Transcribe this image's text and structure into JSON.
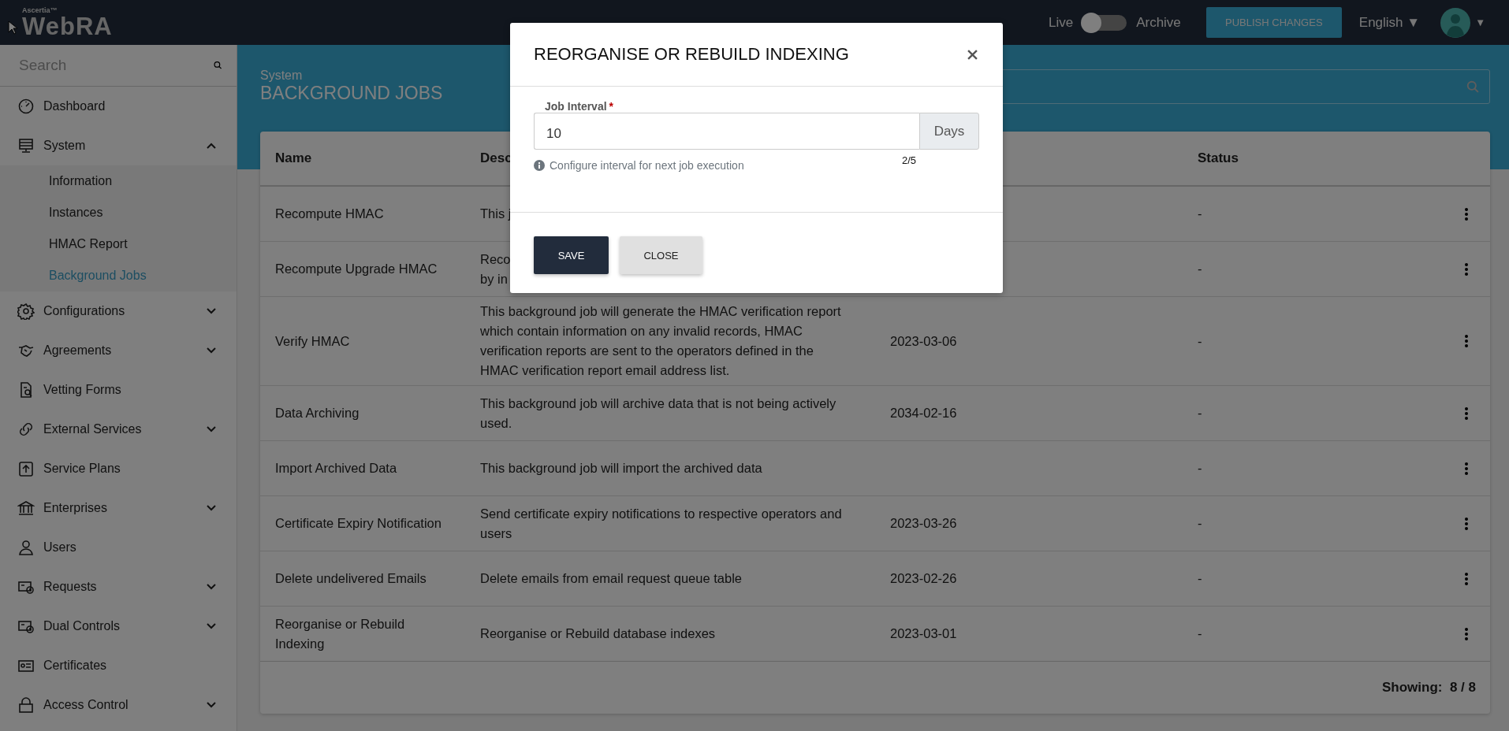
{
  "topbar": {
    "brand_small": "Ascertia™",
    "brand": "WebRA",
    "toggle": {
      "left_label": "Live",
      "right_label": "Archive",
      "on": false
    },
    "publish_button": "PUBLISH CHANGES",
    "language": "English ▼",
    "avatar_caret": "▼"
  },
  "sidebar": {
    "search": {
      "placeholder": "Search"
    },
    "items": [
      {
        "label": "Dashboard",
        "kind": "link"
      },
      {
        "label": "System",
        "kind": "group",
        "expanded": true,
        "children": [
          {
            "label": "Information",
            "selected": false
          },
          {
            "label": "Instances",
            "selected": false
          },
          {
            "label": "HMAC Report",
            "selected": false
          },
          {
            "label": "Background Jobs",
            "selected": true
          }
        ]
      },
      {
        "label": "Configurations",
        "kind": "group",
        "expanded": false
      },
      {
        "label": "Agreements",
        "kind": "group",
        "expanded": false
      },
      {
        "label": "Vetting Forms",
        "kind": "link"
      },
      {
        "label": "External Services",
        "kind": "group",
        "expanded": false
      },
      {
        "label": "Service Plans",
        "kind": "link"
      },
      {
        "label": "Enterprises",
        "kind": "group",
        "expanded": false
      },
      {
        "label": "Users",
        "kind": "link"
      },
      {
        "label": "Requests",
        "kind": "group",
        "expanded": false
      },
      {
        "label": "Dual Controls",
        "kind": "group",
        "expanded": false
      },
      {
        "label": "Certificates",
        "kind": "link"
      },
      {
        "label": "Access Control",
        "kind": "group",
        "expanded": false
      }
    ]
  },
  "header": {
    "breadcrumb": "System",
    "title": "BACKGROUND JOBS"
  },
  "table": {
    "columns": [
      {
        "kind": "name",
        "label": "Name"
      },
      {
        "kind": "description",
        "label": "Desc"
      },
      {
        "kind": "status",
        "label": "Status"
      }
    ],
    "rows": [
      {
        "name": "Recompute HMAC",
        "description": "This j",
        "status": "-"
      },
      {
        "name": "Recompute Upgrade HMAC",
        "description": "Reco\nby in",
        "status": "-"
      },
      {
        "name": "Verify HMAC",
        "description": "This background job will generate the HMAC verification report which contain information on any invalid records, HMAC verification reports are sent to the operators defined in the HMAC verification report email address list.",
        "date": "2023-03-06",
        "status": "-"
      },
      {
        "name": "Data Archiving",
        "description": "This background job will archive data that is not being actively used.",
        "date": "2034-02-16",
        "status": "-"
      },
      {
        "name": "Import Archived Data",
        "description": "This background job will import the archived data",
        "status": "-"
      },
      {
        "name": "Certificate Expiry Notification",
        "description": "Send certificate expiry notifications to respective operators and users",
        "date": "2023-03-26",
        "status": "-"
      },
      {
        "name": "Delete undelivered Emails",
        "description": "Delete emails from email request queue table",
        "date": "2023-02-26",
        "status": "-"
      },
      {
        "name": "Reorganise or Rebuild Indexing",
        "description": "Reorganise or Rebuild database indexes",
        "date": "2023-03-01",
        "status": "-"
      }
    ],
    "footer": {
      "label": "Showing:",
      "count": "8 / 8"
    }
  },
  "modal": {
    "title": "REORGANISE OR REBUILD INDEXING",
    "field": {
      "label": "Job Interval",
      "required_mark": "*",
      "value": "10",
      "suffix": "Days",
      "counter": "2/5",
      "help": "Configure interval for next job execution"
    },
    "buttons": [
      {
        "label": "SAVE",
        "kind": "primary"
      },
      {
        "label": "CLOSE",
        "kind": "secondary"
      }
    ]
  }
}
